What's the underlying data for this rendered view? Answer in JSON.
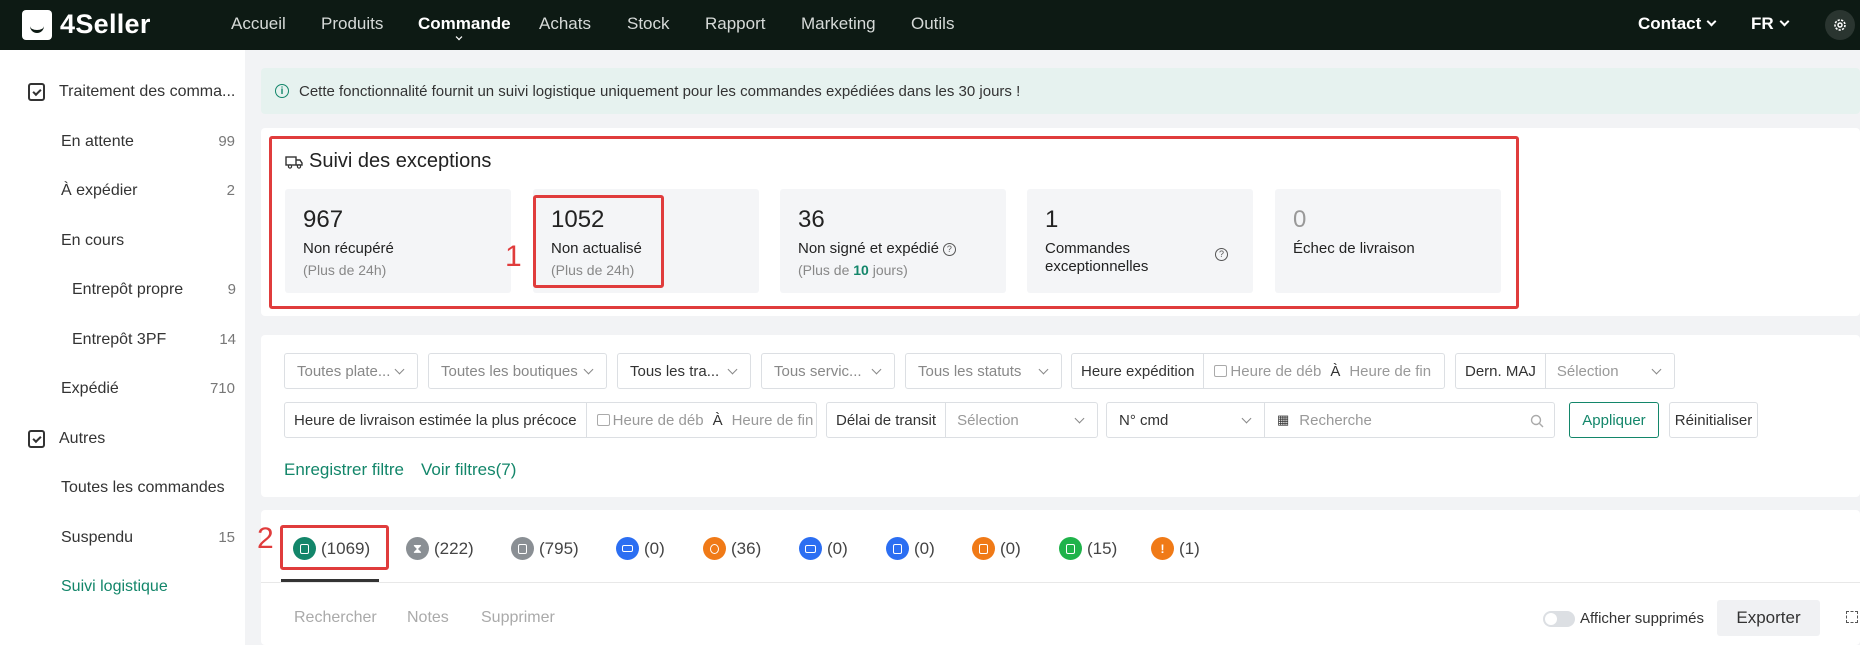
{
  "brand": {
    "name": "4Seller"
  },
  "nav": {
    "items": [
      "Accueil",
      "Produits",
      "Commande",
      "Achats",
      "Stock",
      "Rapport",
      "Marketing",
      "Outils"
    ],
    "active": "Commande",
    "contact": "Contact",
    "language": "FR"
  },
  "sidebar": {
    "group1": "Traitement des comma...",
    "group1_items": [
      {
        "label": "En attente",
        "count": "99"
      },
      {
        "label": "À expédier",
        "count": "2"
      },
      {
        "label": "En cours",
        "count": ""
      },
      {
        "label": "Entrepôt propre",
        "count": "9"
      },
      {
        "label": "Entrepôt 3PF",
        "count": "14"
      },
      {
        "label": "Expédié",
        "count": "710"
      }
    ],
    "group2": "Autres",
    "group2_items": [
      {
        "label": "Toutes les commandes",
        "count": ""
      },
      {
        "label": "Suspendu",
        "count": "15"
      },
      {
        "label": "Suivi logistique",
        "count": ""
      }
    ]
  },
  "notice": "Cette fonctionnalité fournit un suivi logistique uniquement pour les commandes expédiées dans les 30 jours !",
  "exceptions": {
    "title": "Suivi des exceptions",
    "cards": [
      {
        "value": "967",
        "label": "Non récupéré",
        "sub": "(Plus de 24h)"
      },
      {
        "value": "1052",
        "label": "Non actualisé",
        "sub": "(Plus de 24h)"
      },
      {
        "value": "36",
        "label": "Non signé et expédié",
        "sub_prefix": "(Plus de ",
        "sub_num": "10",
        "sub_suffix": " jours)"
      },
      {
        "value": "1",
        "label": "Commandes exceptionnelles",
        "sub": ""
      },
      {
        "value": "0",
        "label": "Échec de livraison",
        "sub": ""
      }
    ]
  },
  "annotations": {
    "one": "1",
    "two": "2"
  },
  "filters": {
    "platform": "Toutes plate...",
    "shops": "Toutes les boutiques",
    "carriers": "Tous les tra...",
    "services": "Tous servic...",
    "statuses": "Tous les statuts",
    "ship_time_label": "Heure expédition",
    "start_ph": "Heure de déb",
    "to": "À",
    "end_ph": "Heure de fin",
    "last_update_label": "Dern. MAJ",
    "select_ph": "Sélection",
    "eta_label": "Heure de livraison estimée la plus précoce",
    "transit_label": "Délai de transit",
    "order_no": "N° cmd",
    "search_ph": "Recherche",
    "apply": "Appliquer",
    "reset": "Réinitialiser",
    "save_filter": "Enregistrer filtre",
    "view_filters": "Voir filtres(7)"
  },
  "tabs": [
    {
      "count": "(1069)",
      "color": "#13866a"
    },
    {
      "count": "(222)",
      "color": "#8a8f94"
    },
    {
      "count": "(795)",
      "color": "#8a8f94"
    },
    {
      "count": "(0)",
      "color": "#2b6ef2"
    },
    {
      "count": "(36)",
      "color": "#f07a17"
    },
    {
      "count": "(0)",
      "color": "#2b6ef2"
    },
    {
      "count": "(0)",
      "color": "#2b6ef2"
    },
    {
      "count": "(0)",
      "color": "#f07a17"
    },
    {
      "count": "(15)",
      "color": "#1fb34a"
    },
    {
      "count": "(1)",
      "color": "#f07a17"
    }
  ],
  "actions": {
    "search": "Rechercher",
    "notes": "Notes",
    "delete": "Supprimer",
    "show_deleted": "Afficher supprimés",
    "export": "Exporter"
  }
}
